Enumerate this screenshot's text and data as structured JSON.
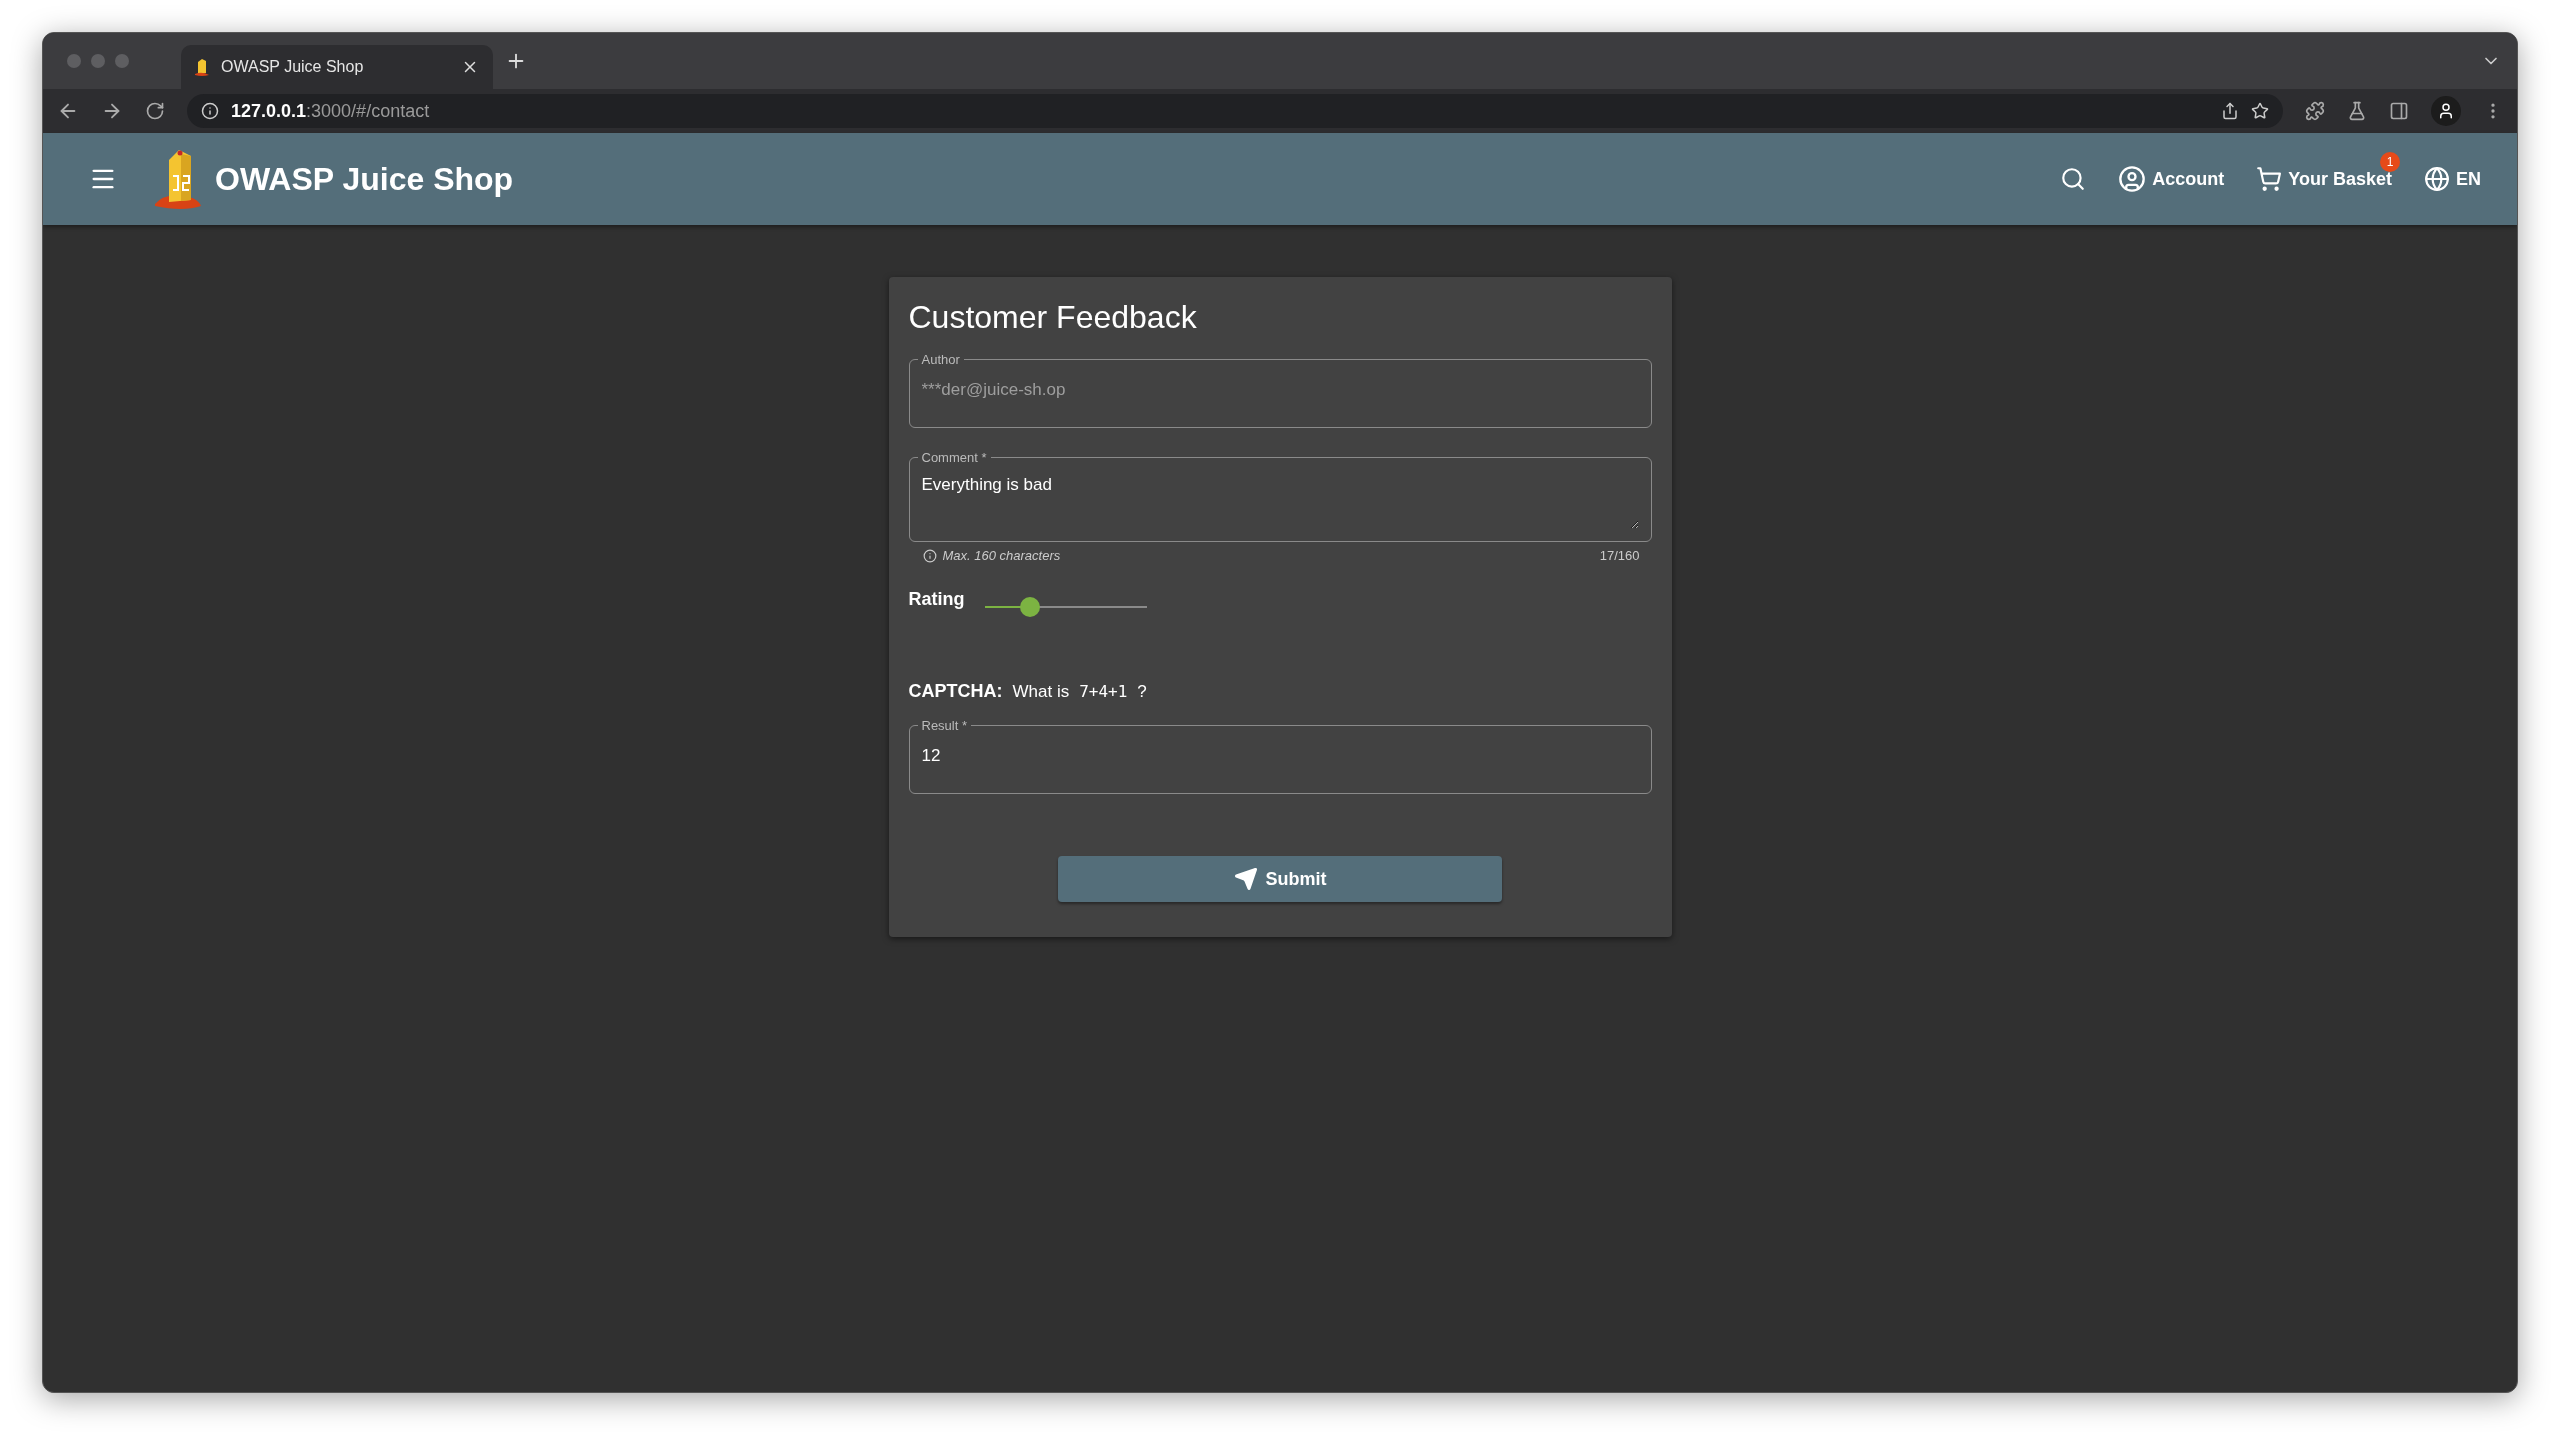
{
  "browser": {
    "tab_title": "OWASP Juice Shop",
    "url_host": "127.0.0.1",
    "url_path": ":3000/#/contact"
  },
  "toolbar": {
    "title": "OWASP Juice Shop",
    "account": "Account",
    "basket": "Your Basket",
    "basket_count": "1",
    "language": "EN"
  },
  "feedback": {
    "title": "Customer Feedback",
    "author": {
      "label": "Author",
      "value": "***der@juice-sh.op",
      "disabled": true
    },
    "comment": {
      "label": "Comment *",
      "value": "Everything is bad"
    },
    "hint": "Max. 160 characters",
    "counter": "17/160",
    "rating": {
      "label": "Rating",
      "level": 0.25
    },
    "captcha": {
      "label": "CAPTCHA:",
      "prefix": "What is",
      "expression": "7+4+1",
      "suffix": "?"
    },
    "result": {
      "label": "Result *",
      "value": "12"
    },
    "submit": "Submit"
  }
}
